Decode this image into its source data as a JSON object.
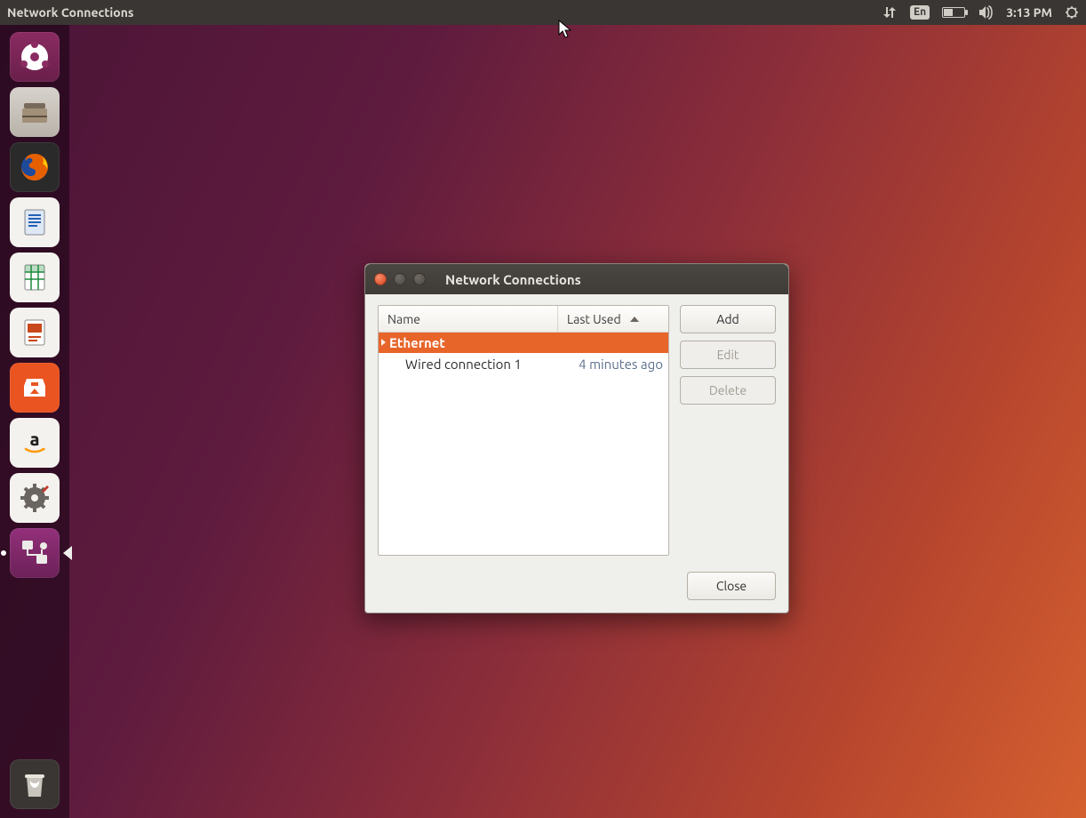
{
  "menubar": {
    "title": "Network Connections",
    "indicators": {
      "language": "En",
      "time": "3:13 PM"
    }
  },
  "launcher": {
    "items": [
      {
        "name": "dash-home-icon"
      },
      {
        "name": "files-icon"
      },
      {
        "name": "firefox-icon"
      },
      {
        "name": "libreoffice-writer-icon"
      },
      {
        "name": "libreoffice-calc-icon"
      },
      {
        "name": "libreoffice-impress-icon"
      },
      {
        "name": "ubuntu-software-icon"
      },
      {
        "name": "amazon-icon"
      },
      {
        "name": "system-settings-icon"
      },
      {
        "name": "network-connections-icon"
      }
    ],
    "trash": {
      "name": "trash-icon"
    }
  },
  "dialog": {
    "title": "Network Connections",
    "columns": {
      "name": "Name",
      "last_used": "Last Used"
    },
    "group": "Ethernet",
    "connection": {
      "name": "Wired connection 1",
      "last_used": "4 minutes ago"
    },
    "buttons": {
      "add": "Add",
      "edit": "Edit",
      "delete": "Delete",
      "close": "Close"
    }
  }
}
